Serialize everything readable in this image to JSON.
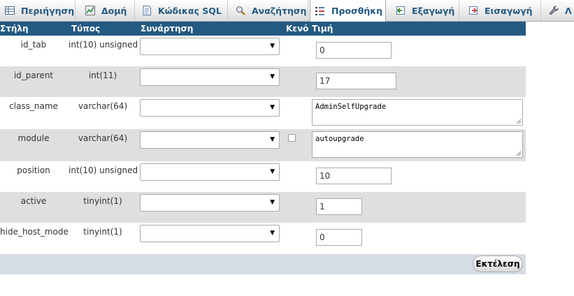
{
  "tabs": [
    {
      "label": "Περιήγηση",
      "icon": "browse-icon"
    },
    {
      "label": "Δομή",
      "icon": "structure-icon"
    },
    {
      "label": "Κώδικας SQL",
      "icon": "sql-icon"
    },
    {
      "label": "Αναζήτηση",
      "icon": "search-icon"
    },
    {
      "label": "Προσθήκη",
      "icon": "insert-icon",
      "active": true
    },
    {
      "label": "Εξαγωγή",
      "icon": "export-icon"
    },
    {
      "label": "Εισαγωγή",
      "icon": "import-icon"
    },
    {
      "label": "Λ",
      "icon": "operations-icon"
    }
  ],
  "table": {
    "headers": {
      "column": "Στήλη",
      "type": "Τύπος",
      "function": "Συνάρτηση",
      "null": "Κενό",
      "value": "Τιμή"
    },
    "rows": [
      {
        "name": "id_tab",
        "type": "int(10) unsigned",
        "function": "",
        "value": "0"
      },
      {
        "name": "id_parent",
        "type": "int(11)",
        "function": "",
        "value": "17"
      },
      {
        "name": "class_name",
        "type": "varchar(64)",
        "function": "",
        "value": "AdminSelfUpgrade"
      },
      {
        "name": "module",
        "type": "varchar(64)",
        "function": "",
        "null_checked": false,
        "value": "autoupgrade"
      },
      {
        "name": "position",
        "type": "int(10) unsigned",
        "function": "",
        "value": "10"
      },
      {
        "name": "active",
        "type": "tinyint(1)",
        "function": "",
        "value": "1"
      },
      {
        "name": "hide_host_mode",
        "type": "tinyint(1)",
        "function": "",
        "value": "0"
      }
    ]
  },
  "footer": {
    "go_label": "Εκτέλεση"
  },
  "colors": {
    "header_bg": "#235a81",
    "tab_text": "#235a81",
    "row_alt": "#dfdfdf",
    "footer_bg": "#d6dde4"
  }
}
